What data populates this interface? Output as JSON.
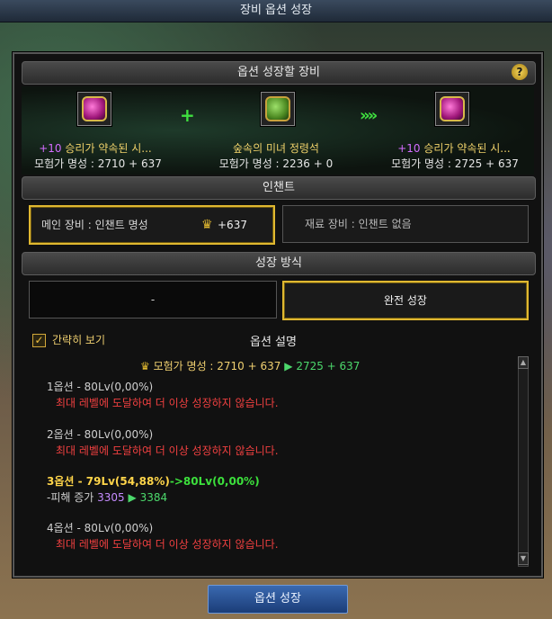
{
  "window_title": "장비 옵션 성장",
  "sections": {
    "target": "옵션 성장할 장비",
    "enchant": "인챈트",
    "method": "성장 방식"
  },
  "help_icon": "?",
  "items": {
    "main": {
      "plus": "+10",
      "name": "승리가 약속된 시...",
      "fame": "모험가 명성 : 2710 + 637"
    },
    "material": {
      "name": "숲속의 미녀 정령석",
      "fame": "모험가 명성 : 2236 + 0"
    },
    "result": {
      "plus": "+10",
      "name": "승리가 약속된 시...",
      "fame": "모험가 명성 : 2725 + 637"
    }
  },
  "symbols": {
    "plus": "+",
    "arrows": "»»"
  },
  "enchant": {
    "main_label": "메인 장비 : 인챈트 명성",
    "main_value": "+637",
    "material_label": "재료 장비 : 인챈트 없음"
  },
  "method": {
    "left": "-",
    "right": "완전 성장"
  },
  "simple_view": {
    "label": "간략히 보기",
    "checked": true,
    "mark": "✓"
  },
  "option_desc_title": "옵션 설명",
  "fame_line": {
    "label": "모험가 명성 : 2710 + 637",
    "arrow": "▶",
    "to": "2725 + 637"
  },
  "options": [
    {
      "title": "1옵션 - 80Lv(0,00%)",
      "desc": "최대 레벨에 도달하여 더 이상 성장하지 않습니다."
    },
    {
      "title": "2옵션 - 80Lv(0,00%)",
      "desc": "최대 레벨에 도달하여 더 이상 성장하지 않습니다."
    },
    {
      "title_a": "3옵션 - 79Lv(54,88%)",
      "title_b": "->80Lv(0,00%)",
      "effect_label": "-피해 증가",
      "effect_from": "3305",
      "effect_arrow": "▶",
      "effect_to": "3384"
    },
    {
      "title": "4옵션 - 80Lv(0,00%)",
      "desc": "최대 레벨에 도달하여 더 이상 성장하지 않습니다."
    }
  ],
  "grow_button": "옵션 성장",
  "colors": {
    "accent_gold": "#e0b830",
    "red_text": "#f04040",
    "green_text": "#3ce03c",
    "button_blue": "#2a55a0"
  }
}
